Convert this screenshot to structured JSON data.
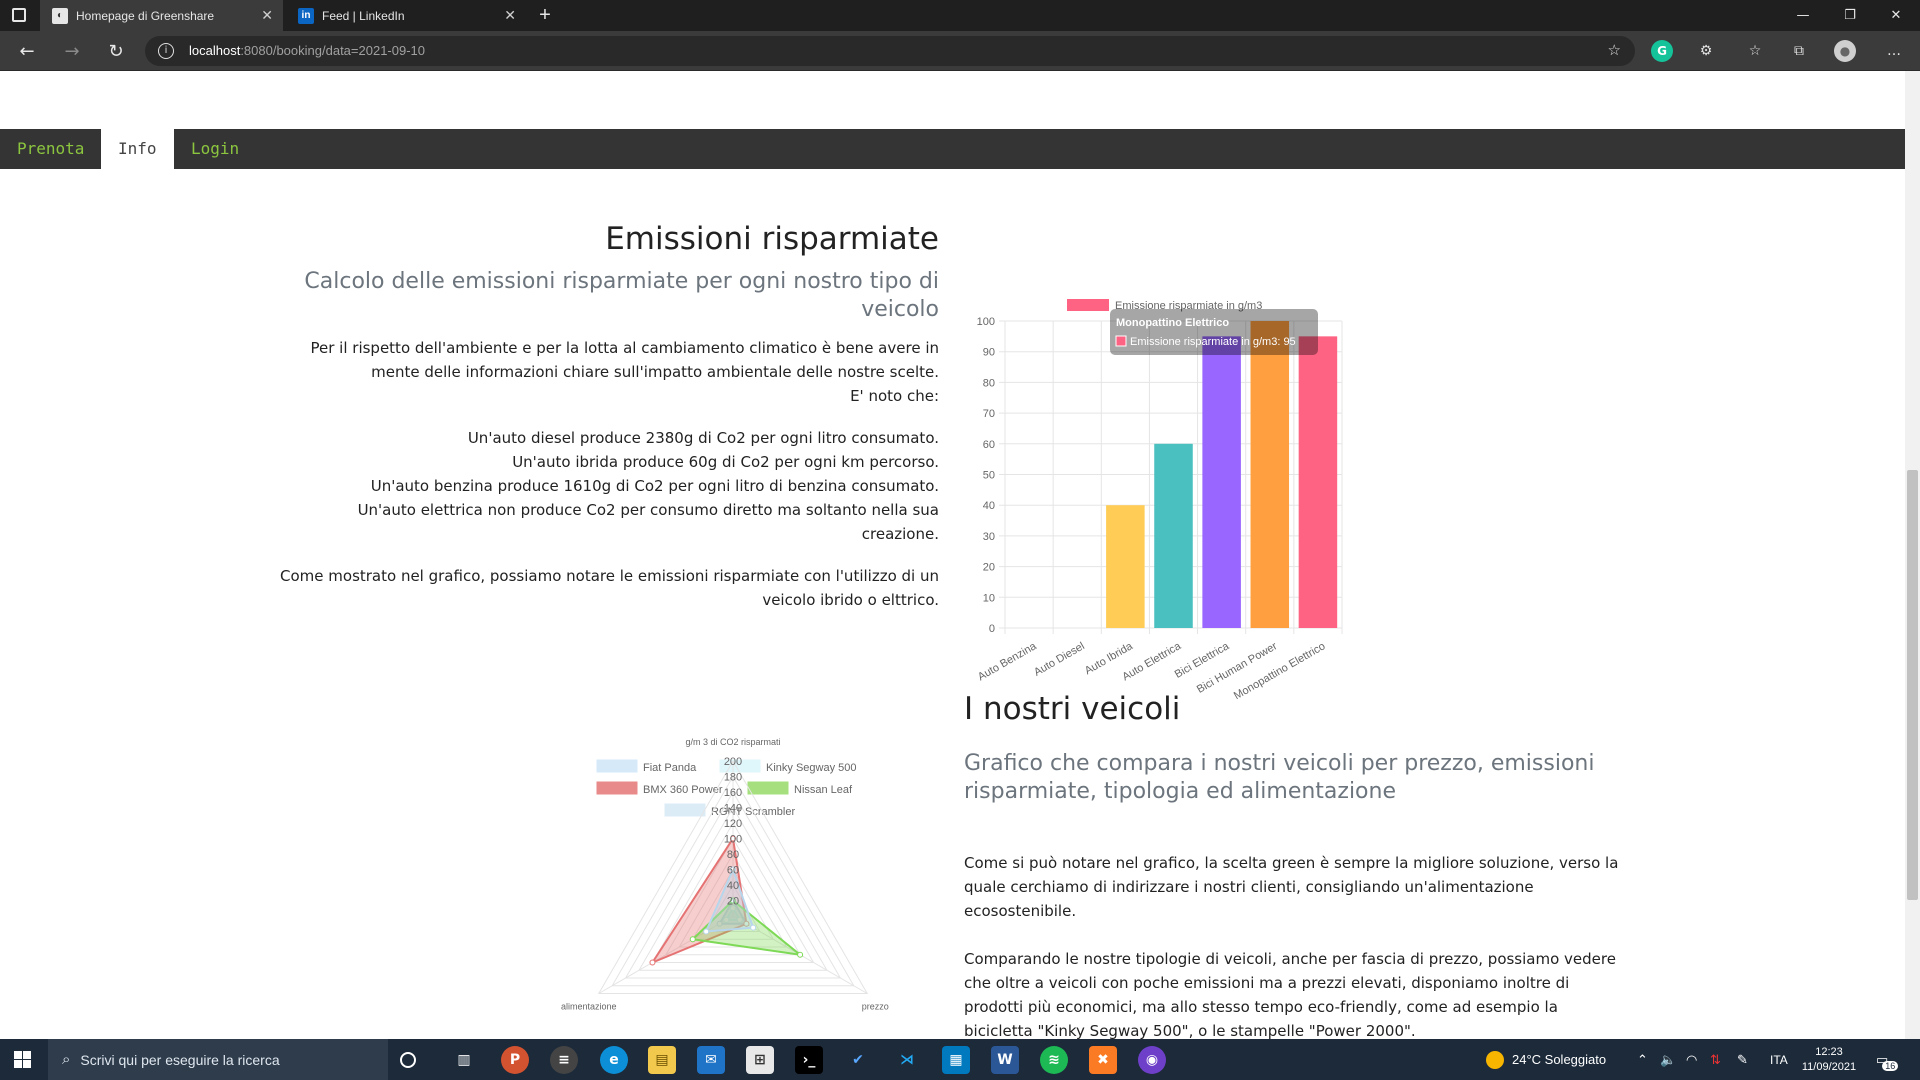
{
  "browser": {
    "tabs": [
      {
        "title": "Homepage di Greenshare",
        "active": true
      },
      {
        "title": "Feed | LinkedIn",
        "active": false
      }
    ],
    "url_host": "localhost",
    "url_rest": ":8080/booking/data=2021-09-10"
  },
  "nav": {
    "items": [
      {
        "label": "Prenota",
        "active": false
      },
      {
        "label": "Info",
        "active": true
      },
      {
        "label": "Login",
        "active": false
      }
    ]
  },
  "section1": {
    "title": "Emissioni risparmiate",
    "subtitle_line1": "Calcolo delle emissioni risparmiate per ogni nostro tipo di",
    "subtitle_line2": "veicolo",
    "lines": [
      "Per il rispetto dell'ambiente e per la lotta al cambiamento climatico è bene avere in",
      "mente delle informazioni chiare sull'impatto ambientale delle nostre scelte.",
      "E' noto che:",
      "",
      "Un'auto diesel produce 2380g di Co2 per ogni litro consumato.",
      "Un'auto ibrida produce 60g di Co2 per ogni km percorso.",
      "Un'auto benzina produce 1610g di Co2 per ogni litro di benzina consumato.",
      "Un'auto elettrica non produce Co2 per consumo diretto ma soltanto nella sua",
      "creazione.",
      "",
      "Come mostrato nel grafico, possiamo notare le emissioni risparmiate con l'utilizzo di un",
      "veicolo ibrido o elttrico."
    ]
  },
  "section2": {
    "title": "I nostri veicoli",
    "subtitle_line1": "Grafico che compara i nostri veicoli per prezzo, emissioni",
    "subtitle_line2": "risparmiate, tipologia ed alimentazione",
    "lines": [
      "Come si può notare nel grafico, la scelta green è sempre la migliore soluzione, verso la",
      "quale cerchiamo di indirizzare i nostri clienti, consigliando un'alimentazione",
      "ecosostenibile.",
      "",
      "Comparando le nostre tipologie di veicoli, anche per fascia di prezzo, possiamo vedere",
      "che oltre a veicoli con poche emissioni ma a prezzi elevati, disponiamo inoltre di",
      "prodotti più economici, ma allo stesso tempo eco-friendly, come ad esempio la",
      "bicicletta \"Kinky Segway 500\", o le stampelle \"Power 2000\"."
    ]
  },
  "chart_data": [
    {
      "type": "bar",
      "legend": "Emissione risparmiate in g/m3",
      "categories": [
        "Auto Benzina",
        "Auto Diesel",
        "Auto Ibrida",
        "Auto Elettrica",
        "Bici Elettrica",
        "Bici Human Power",
        "Monopattino Elettrico"
      ],
      "values": [
        0,
        0,
        40,
        60,
        95,
        100,
        95
      ],
      "colors": [
        "#ff6384",
        "#ff9f40",
        "#ffcd56",
        "#4bc0c0",
        "#9966ff",
        "#ff9f40",
        "#ff6384"
      ],
      "ylim": [
        0,
        100
      ],
      "yticks": [
        "0",
        "10",
        "20",
        "30",
        "40",
        "50",
        "60",
        "70",
        "80",
        "90",
        "100"
      ],
      "tooltip_title": "Monopattino Elettrico",
      "tooltip_body": "Emissione risparmiate in g/m3: 95",
      "grid": true
    },
    {
      "type": "radar",
      "axes": [
        "g/m 3 di CO2 risparmati",
        "prezzo",
        "alimentazione"
      ],
      "rticks": [
        "20",
        "40",
        "60",
        "80",
        "100",
        "120",
        "140",
        "160",
        "180",
        "200"
      ],
      "rlim": [
        0,
        200
      ],
      "legend": [
        {
          "name": "Fiat Panda",
          "color": "#d6e9f8"
        },
        {
          "name": "Kinky Segway 500",
          "color": "#dff6fb"
        },
        {
          "name": "BMX 360 Power",
          "color": "#e88a8a"
        },
        {
          "name": "Nissan Leaf",
          "color": "#a6e07e"
        },
        {
          "name": "RGNT Scrambler",
          "color": "#dcecf7"
        }
      ],
      "series": [
        {
          "name": "Fiat Panda",
          "values": [
            20,
            20,
            20
          ],
          "color": "#a9cde8"
        },
        {
          "name": "Kinky Segway 500",
          "values": [
            10,
            10,
            10
          ],
          "color": "#b3ecf5"
        },
        {
          "name": "BMX 360 Power",
          "values": [
            100,
            20,
            120
          ],
          "color": "#e57373"
        },
        {
          "name": "Nissan Leaf",
          "values": [
            20,
            100,
            60
          ],
          "color": "#7ed957"
        },
        {
          "name": "RGNT Scrambler",
          "values": [
            60,
            30,
            40
          ],
          "color": "#b7d6ec"
        }
      ]
    }
  ],
  "taskbar": {
    "search_placeholder": "Scrivi qui per eseguire la ricerca",
    "weather": "24°C Soleggiato",
    "lang": "ITA",
    "time": "12:23",
    "date": "11/09/2021",
    "notifications": "16"
  }
}
